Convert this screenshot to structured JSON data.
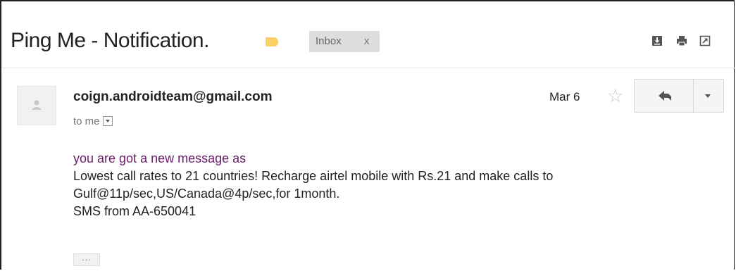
{
  "header": {
    "subject": "Ping Me - Notification.",
    "label_color": "#fad165",
    "inbox_chip": {
      "label": "Inbox",
      "remove": "x"
    },
    "tools": [
      "download-icon",
      "print-icon",
      "new-window-icon"
    ]
  },
  "message": {
    "sender": "coign.androidteam@gmail.com",
    "recipient": "to me",
    "date": "Mar 6",
    "star_icon": "star-outline-icon",
    "reply_icon": "reply-icon",
    "more_icon": "chevron-down-icon",
    "body": {
      "intro": "you are got a new message as",
      "line1": "Lowest call rates to 21 countries! Recharge airtel mobile with Rs.21 and make calls to",
      "line2": "Gulf@11p/sec,US/Canada@4p/sec,for 1month.",
      "line3": "SMS from AA-650041"
    },
    "trimmed_content_label": "..."
  }
}
